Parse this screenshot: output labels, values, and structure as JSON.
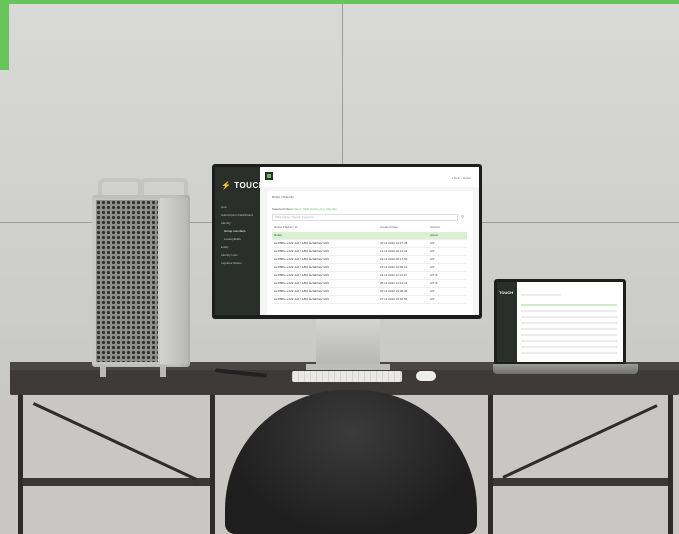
{
  "brand": {
    "name": "TOUCH",
    "accent_color": "#66c45a",
    "sidebar_color": "#2a2f2c"
  },
  "monitor_app": {
    "top_right": "1 Hub  ⌂ Robot",
    "sidebar_items": [
      {
        "label": "Hub",
        "active": false
      },
      {
        "label": "Subscription Dashboard",
        "active": false
      },
      {
        "label": "Identity",
        "active": false
      },
      {
        "label": "Group members",
        "active": true
      },
      {
        "label": "Lookupfields",
        "active": false
      },
      {
        "label": "Entity",
        "active": false
      },
      {
        "label": "Identity Lists",
        "active": false
      },
      {
        "label": "Inquiries Status",
        "active": false
      }
    ],
    "breadcrumb": "Robot / #Identity",
    "filter_label": "Selected Filters",
    "filter_values": "Name: Wild Hunter, Ipp: Member",
    "search_placeholder": "Wild Hunter Search Keyword",
    "table": {
      "headers": [
        "Robot Platform Id",
        "Created Date",
        "Actions"
      ],
      "rows": [
        [
          "Robot",
          "",
          "Action"
        ],
        [
          "2e4f88fe-e429-4d17-b8fd-0e54b62e7205",
          "20.11.2022 14:37:38",
          "A/T"
        ],
        [
          "2e4f88fe-e429-4d17-b8fd-0e54b62e7205",
          "21.11.2022 09:12:02",
          "A/T"
        ],
        [
          "2e4f88fe-e429-4d17-b8fd-0e54b62e7205",
          "22.11.2022 08:47:50",
          "A/T"
        ],
        [
          "2e4f88fe-e429-4d17-b8fd-0e54b62e7205",
          "23.11.2022 10:05:19",
          "A/T"
        ],
        [
          "2e4f88fe-e429-4d17-b8fd-0e54b62e7205",
          "24.11.2022 11:21:07",
          "A/T B"
        ],
        [
          "2e4f88fe-e429-4d17-b8fd-0e54b62e7205",
          "25.11.2022 13:44:31",
          "A/T B"
        ],
        [
          "2e4f88fe-e429-4d17-b8fd-0e54b62e7205",
          "26.11.2022 15:09:46",
          "A/T"
        ],
        [
          "2e4f88fe-e429-4d17-b8fd-0e54b62e7205",
          "27.11.2022 16:30:55",
          "A/T"
        ]
      ],
      "highlighted_row_index": 0
    }
  },
  "laptop_app": {
    "logo": "TOUCH"
  }
}
